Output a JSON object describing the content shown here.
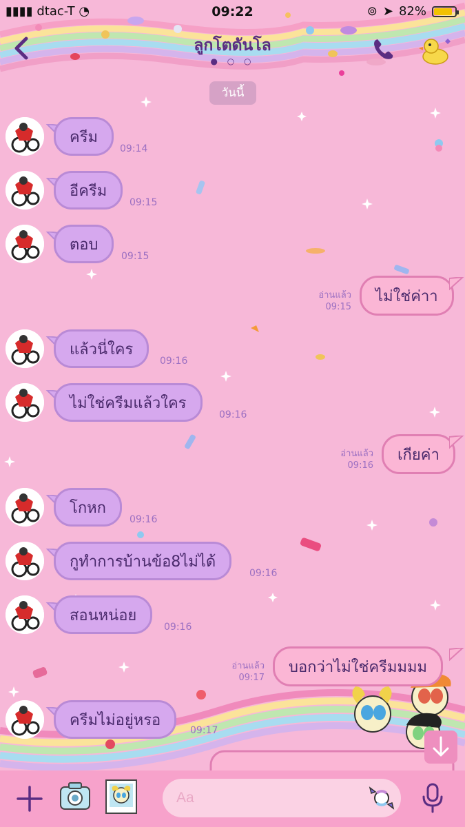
{
  "status_bar": {
    "carrier": "dtac-T",
    "time": "09:22",
    "battery": "82%"
  },
  "header": {
    "title": "ลูกโตดันโล",
    "page_dots": "● ○ ○"
  },
  "date_chip": "วันนี้",
  "messages": [
    {
      "side": "in",
      "text": "ครีม",
      "time": "09:14"
    },
    {
      "side": "in",
      "text": "อีครีม",
      "time": "09:15"
    },
    {
      "side": "in",
      "text": "ตอบ",
      "time": "09:15"
    },
    {
      "side": "out",
      "text": "ไม่ใช่ค่าา",
      "time": "09:15",
      "read": "อ่านแล้ว"
    },
    {
      "side": "in",
      "text": "แล้วนี่ใคร",
      "time": "09:16"
    },
    {
      "side": "in",
      "text": "ไม่ใช่ครีมแล้วใคร",
      "time": "09:16"
    },
    {
      "side": "out",
      "text": "เกียค่า",
      "time": "09:16",
      "read": "อ่านแล้ว"
    },
    {
      "side": "in",
      "text": "โกหก",
      "time": "09:16"
    },
    {
      "side": "in",
      "text": "กูทำการบ้านข้อ8ไม่ได้",
      "time": "09:16"
    },
    {
      "side": "in",
      "text": "สอนหน่อย",
      "time": "09:16"
    },
    {
      "side": "out",
      "text": "บอกว่าไม่ใช่ครีมมมม",
      "time": "09:17",
      "read": "อ่านแล้ว"
    },
    {
      "side": "in",
      "text": "ครีมไม่อยู่หรอ",
      "time": "09:17"
    }
  ],
  "input": {
    "placeholder": "Aa"
  },
  "icons": {
    "back": "chevron-left-icon",
    "call": "phone-icon",
    "menu": "duck-icon",
    "add": "plus-icon",
    "camera": "camera-icon",
    "gallery": "photo-icon",
    "sticker": "candy-icon",
    "voice": "microphone-icon",
    "scroll_down": "arrow-down-icon"
  },
  "colors": {
    "background": "#f7b8d8",
    "incoming_bubble": "#d6a8ee",
    "outgoing_bubble": "#fbb6d5",
    "title": "#5a2d82",
    "footer": "#f7a2cb"
  }
}
